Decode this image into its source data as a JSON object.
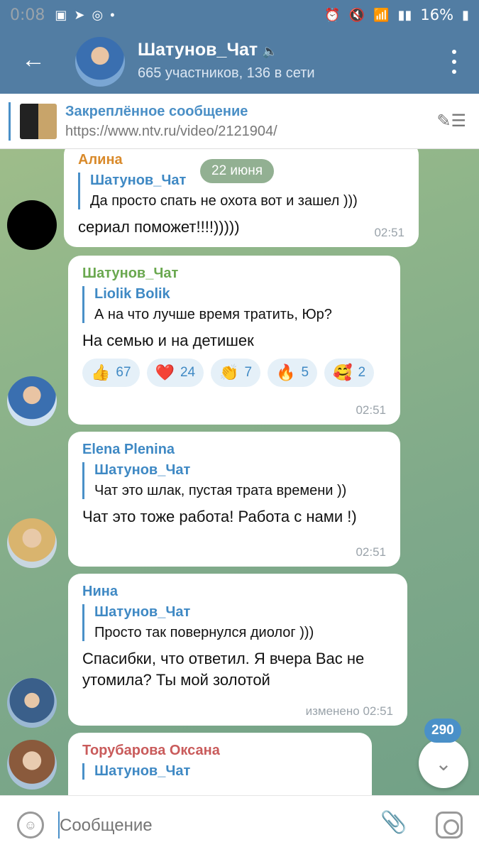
{
  "status": {
    "time": "0:08",
    "battery": "16%"
  },
  "header": {
    "title": "Шатунов_Чат",
    "subtitle": "665 участников, 136 в сети"
  },
  "pinned": {
    "title": "Закреплённое сообщение",
    "link": "https://www.ntv.ru/video/2121904/"
  },
  "date_chip": "22 июня",
  "messages": [
    {
      "author": "Алина",
      "reply_name": "Шатунов_Чат",
      "reply_text": "Да просто спать не охота вот и зашел )))",
      "text": "сериал поможет!!!!)))))",
      "time": "02:51",
      "author_color": "#d98a2b"
    },
    {
      "author": "Шатунов_Чат",
      "reply_name": "Liolik Bolik",
      "reply_text": "А на что лучше время тратить, Юр?",
      "text": "На семью и на детишек",
      "time": "02:51",
      "author_color": "#6aa84f",
      "reactions": [
        {
          "emoji": "👍",
          "count": "67"
        },
        {
          "emoji": "❤️",
          "count": "24"
        },
        {
          "emoji": "👏",
          "count": "7"
        },
        {
          "emoji": "🔥",
          "count": "5"
        },
        {
          "emoji": "🥰",
          "count": "2"
        }
      ]
    },
    {
      "author": "Elena Plenina",
      "reply_name": "Шатунов_Чат",
      "reply_text": "Чат это шлак, пустая трата времени ))",
      "text": "Чат это тоже работа! Работа с нами !)",
      "time": "02:51",
      "author_color": "#3f89c4"
    },
    {
      "author": "Нина",
      "reply_name": "Шатунов_Чат",
      "reply_text": "Просто так повернулся диолог )))",
      "text": "Спасибки, что ответил. Я вчера Вас не утомила?  Ты мой золотой",
      "time": "изменено 02:51",
      "author_color": "#3f89c4"
    },
    {
      "author": "Торубарова Оксана",
      "reply_name": "Шатунов_Чат",
      "author_color": "#c95b5b"
    }
  ],
  "unread_badge": "290",
  "composer": {
    "placeholder": "Сообщение"
  }
}
